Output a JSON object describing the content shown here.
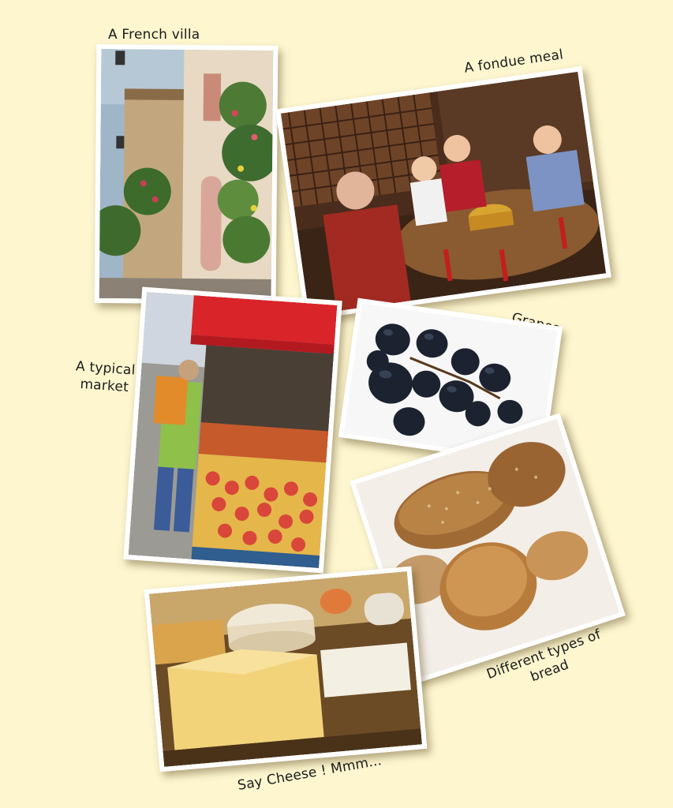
{
  "captions": {
    "villa": "A French villa",
    "fondue": "A fondue meal",
    "grapes": "Grapes",
    "market_line1": "A typical",
    "market_line2": "market",
    "bread_line1": "Different types of",
    "bread_line2": "bread",
    "cheese": "Say Cheese ! Mmm..."
  },
  "colors": {
    "background": "#fdf6cf",
    "frame": "#ffffff"
  }
}
